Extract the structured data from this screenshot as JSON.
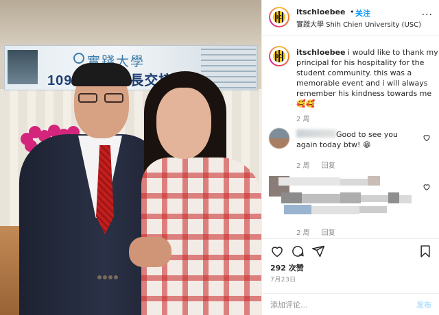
{
  "photo": {
    "banner_school": "實踐大學",
    "banner_event": "109學年度校長交接典禮"
  },
  "header": {
    "username": "itschloebee",
    "dot": "•",
    "follow_label": "关注",
    "location": "實踐大學 Shih Chien University (USC)",
    "more_label": "···",
    "avatar_text": "IC"
  },
  "caption": {
    "username": "itschloebee",
    "text": "i would like to thank my principal for his hospitality for the student community. this was a memorable event and i will always remember his kindness towards me",
    "emoji": "🥰🥰",
    "time": "2 周"
  },
  "comments": [
    {
      "text": "Good to see you again today btw!",
      "emoji": "😁",
      "time": "2 周",
      "reply_label": "回复"
    },
    {
      "time": "2 周",
      "reply_label": "回复"
    }
  ],
  "actions": {
    "likes": "292 次赞",
    "date": "7月23日"
  },
  "add_comment": {
    "placeholder": "添加评论...",
    "post_label": "发布"
  },
  "colors": {
    "accent_blue": "#0095f6",
    "post_button_disabled": "#b2dffc",
    "secondary_text": "#8e8e8e",
    "primary_text": "#262626",
    "divider": "#efefef"
  }
}
